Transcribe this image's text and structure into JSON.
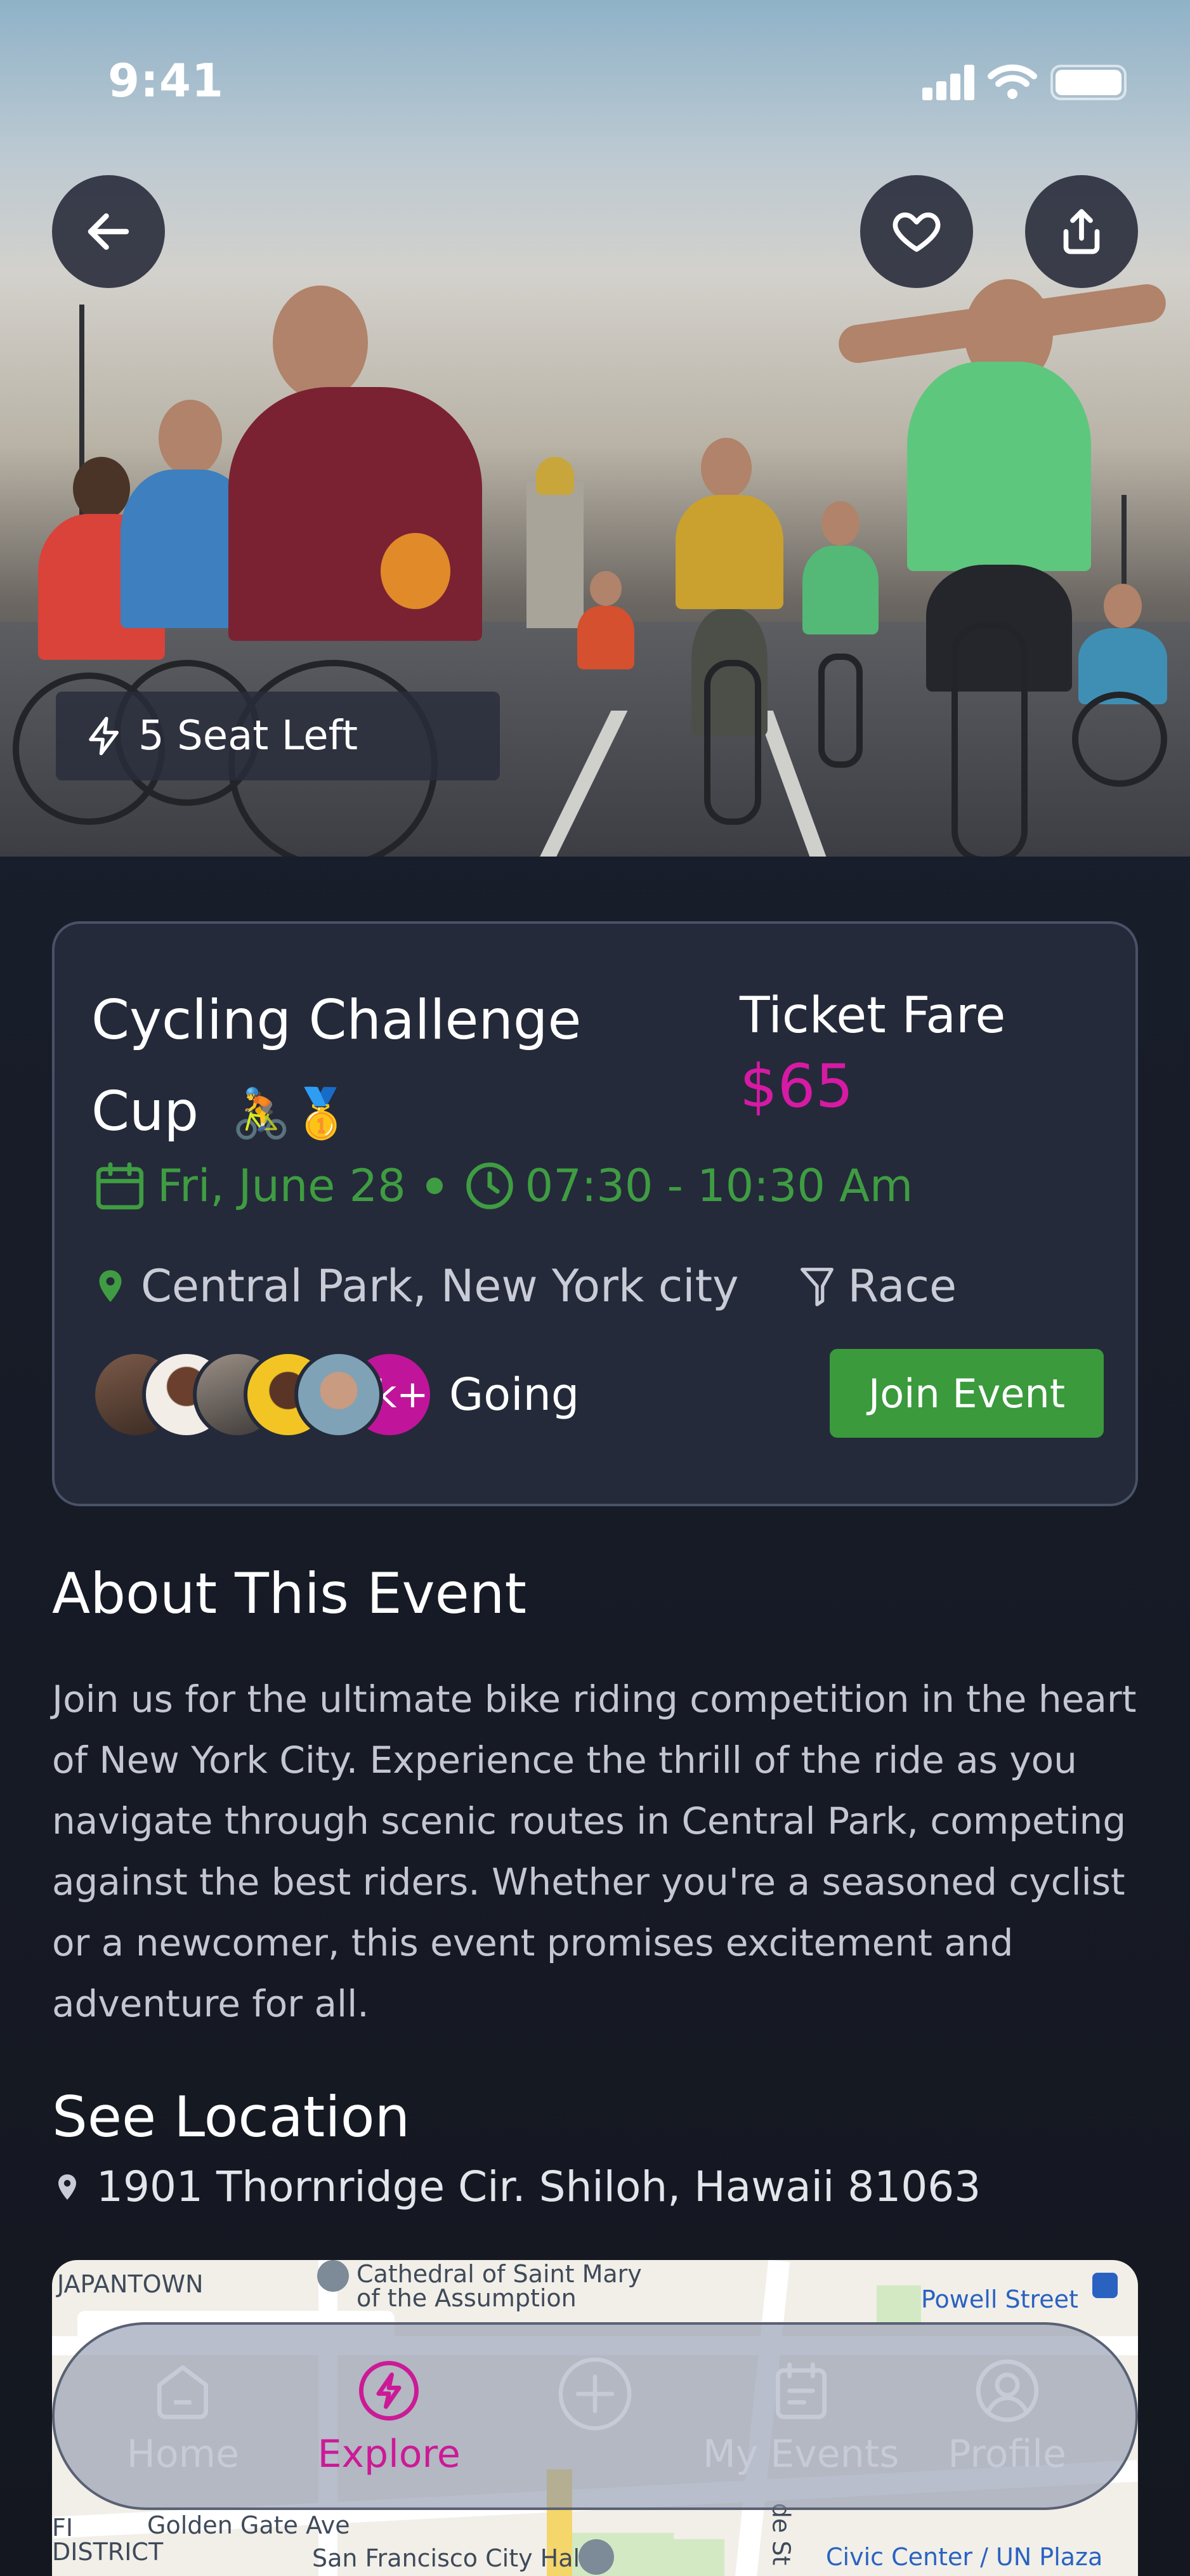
{
  "status_bar": {
    "time": "9:41"
  },
  "hero": {
    "seats_left": "5 Seat Left"
  },
  "event": {
    "title": "Cycling Challenge Cup",
    "title_emoji": "🚴🥇",
    "ticket_label": "Ticket Fare",
    "price": "$65",
    "date": "Fri, June 28",
    "time": "07:30 - 10:30 Am",
    "location": "Central Park, New York city",
    "category": "Race",
    "attendees_more": "2k+",
    "going_label": "Going",
    "join_label": "Join Event"
  },
  "about": {
    "title": "About This Event",
    "text": "Join us for the ultimate bike riding competition in the heart of New York City. Experience the thrill of the ride as you navigate through scenic routes in Central Park, competing against the best riders. Whether you're a seasoned cyclist or a newcomer, this event promises excitement and adventure for all."
  },
  "location_section": {
    "title": "See Location",
    "address": "1901 Thornridge Cir. Shiloh, Hawaii 81063"
  },
  "map": {
    "labels": [
      "JAPANTOWN",
      "Cathedral of Saint Mary",
      "of the Assumption",
      "Powell Street",
      "FI",
      "DISTRICT",
      "Golden Gate Ave",
      "San Francisco City Hall",
      "Civic Center / UN Plaza",
      "de St"
    ]
  },
  "nav": {
    "items": [
      {
        "label": "Home",
        "icon": "home-icon"
      },
      {
        "label": "Explore",
        "icon": "explore-icon"
      },
      {
        "label": "",
        "icon": "add-icon"
      },
      {
        "label": "My Events",
        "icon": "calendar-icon"
      },
      {
        "label": "Profile",
        "icon": "profile-icon"
      }
    ]
  },
  "colors": {
    "accent_green": "#3f9c42",
    "accent_pink": "#d61aa4",
    "card_bg": "#242a3a"
  }
}
